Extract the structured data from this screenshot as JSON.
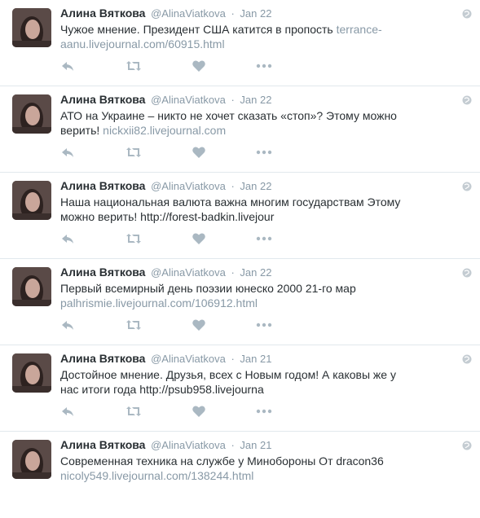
{
  "tweets": [
    {
      "name": "Алина Вяткова",
      "handle": "@AlinaViatkova",
      "date": "Jan 22",
      "text": "Чужое мнение. Президент США катится в пропость ",
      "link": "terrance-aanu.livejournal.com/60915.html"
    },
    {
      "name": "Алина Вяткова",
      "handle": "@AlinaViatkova",
      "date": "Jan 22",
      "text": "АТО на Украине – никто не хочет сказать «стоп»? Этому можно верить! ",
      "link": "nickxii82.livejournal.com"
    },
    {
      "name": "Алина Вяткова",
      "handle": "@AlinaViatkova",
      "date": "Jan 22",
      "text": "Наша национальная валюта важна многим государствам Этому можно верить! http://forest-badkin.livejour",
      "link": ""
    },
    {
      "name": "Алина Вяткова",
      "handle": "@AlinaViatkova",
      "date": "Jan 22",
      "text": "Первый всемирный день поэзии юнеско 2000 21-го мар ",
      "link": "palhrismie.livejournal.com/106912.html"
    },
    {
      "name": "Алина Вяткова",
      "handle": "@AlinaViatkova",
      "date": "Jan 21",
      "text": "Достойное мнение. Друзья, всех с Новым годом! А каковы же у нас итоги года http://psub958.livejourna",
      "link": ""
    },
    {
      "name": "Алина Вяткова",
      "handle": "@AlinaViatkova",
      "date": "Jan 21",
      "text": "Современная техника на службе у Минобороны От dracon36 ",
      "link": "nicoly549.livejournal.com/138244.html"
    }
  ],
  "separator": "·",
  "icons": {
    "reply": "reply-icon",
    "retweet": "retweet-icon",
    "like": "heart-icon",
    "more": "more-icon",
    "globe": "globe-icon"
  },
  "colors": {
    "name": "#292f33",
    "muted": "#8899a6",
    "icon": "#aab8c2",
    "divider": "#e1e8ed"
  }
}
